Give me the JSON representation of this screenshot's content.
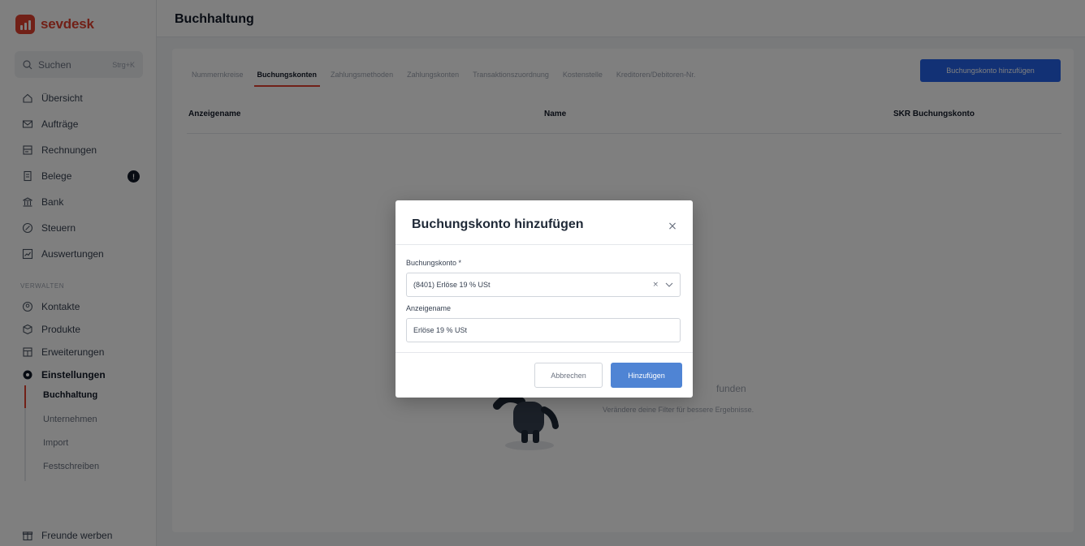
{
  "app": {
    "brand": "sevdesk",
    "brand_color": "#e2402f",
    "accent_color": "#2563eb"
  },
  "sidebar": {
    "search": {
      "label": "Suchen",
      "hint": "Strg+K",
      "icon": "search-icon"
    },
    "items": [
      {
        "label": "Übersicht",
        "icon": "home-icon"
      },
      {
        "label": "Aufträge",
        "icon": "mail-icon"
      },
      {
        "label": "Rechnungen",
        "icon": "invoice-icon"
      },
      {
        "label": "Belege",
        "icon": "receipt-icon",
        "badge": "!"
      },
      {
        "label": "Bank",
        "icon": "bank-icon"
      },
      {
        "label": "Steuern",
        "icon": "tax-icon"
      },
      {
        "label": "Auswertungen",
        "icon": "chart-icon"
      }
    ],
    "section_label": "VERWALTEN",
    "manage_items": [
      {
        "label": "Kontakte",
        "icon": "contacts-icon"
      },
      {
        "label": "Produkte",
        "icon": "products-icon"
      },
      {
        "label": "Erweiterungen",
        "icon": "extensions-icon"
      },
      {
        "label": "Einstellungen",
        "icon": "settings-icon"
      }
    ],
    "settings_sub": [
      {
        "label": "Buchhaltung",
        "active": true
      },
      {
        "label": "Unternehmen",
        "active": false
      },
      {
        "label": "Import",
        "active": false
      },
      {
        "label": "Festschreiben",
        "active": false
      }
    ],
    "footer": {
      "label": "Freunde werben",
      "icon": "gift-icon"
    }
  },
  "header": {
    "title": "Buchhaltung"
  },
  "main": {
    "tabs": [
      {
        "label": "Nummernkreise",
        "active": false
      },
      {
        "label": "Buchungskonten",
        "active": true
      },
      {
        "label": "Zahlungsmethoden",
        "active": false
      },
      {
        "label": "Zahlungskonten",
        "active": false
      },
      {
        "label": "Transaktionszuordnung",
        "active": false
      },
      {
        "label": "Kostenstelle",
        "active": false
      },
      {
        "label": "Kreditoren/Debitoren-Nr.",
        "active": false
      }
    ],
    "add_button": "Buchungskonto hinzufügen",
    "columns": [
      "Anzeigename",
      "Name",
      "SKR Buchungskonto"
    ],
    "empty_state": {
      "title_fragment": "funden",
      "subtitle": "Verändere deine Filter für bessere Ergebnisse."
    }
  },
  "modal": {
    "title": "Buchungskonto hinzufügen",
    "close": "×",
    "account_label": "Buchungskonto *",
    "account_value": "(8401) Erlöse 19 % USt",
    "clear": "×",
    "display_label": "Anzeigename",
    "display_value": "Erlöse 19 % USt",
    "cancel_button": "Abbrechen",
    "submit_button": "Hinzufügen"
  }
}
